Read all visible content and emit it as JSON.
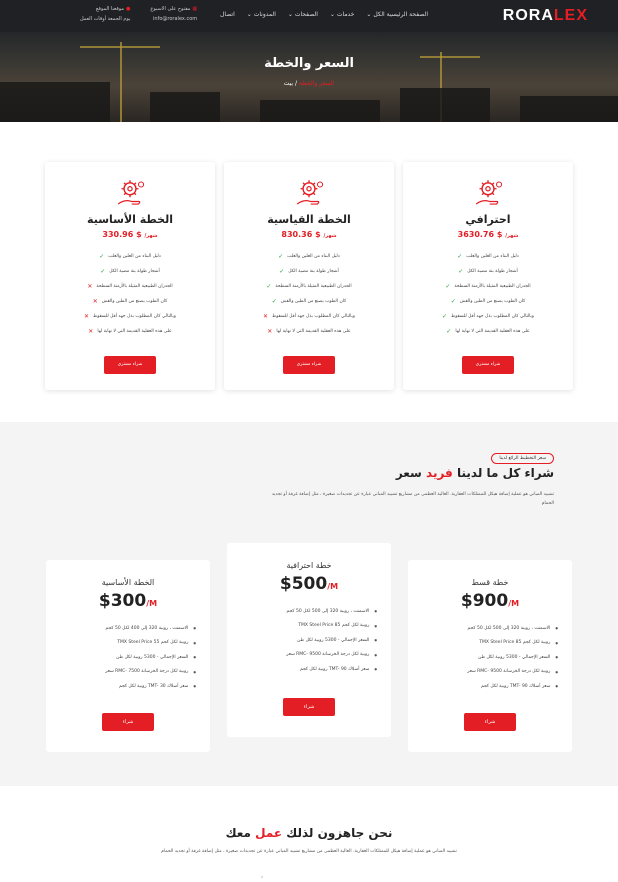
{
  "header": {
    "logo_main": "RORA",
    "logo_accent": "LEX",
    "nav": [
      "الصفحة الرئيسية الكل",
      "خدمات",
      "الصفحات",
      "المدونات",
      "اتصال"
    ],
    "contact": {
      "hours_label": "مفتوح على الاسبوع",
      "hours_value": "يوم الجمعة أوقات العمل",
      "location_label": "موقعنا الموقع",
      "email": "info@roralex.com"
    }
  },
  "hero": {
    "title": "السعر والخطة",
    "crumb_home": "بيت",
    "crumb_sep": " / ",
    "crumb_current": "السعر والخطة"
  },
  "plans_top": [
    {
      "title": "الخطة الأساسية",
      "price": "$ 330.96",
      "per": "شهر/",
      "button": "شراء مشتري",
      "features": [
        {
          "text": "دليل البناء من العلين والعلب",
          "ok": true
        },
        {
          "text": "أشجار طولة بنة مضية الكل",
          "ok": true
        },
        {
          "text": "الجدران الطبيعية المثيلة بالأزمنة السطحة",
          "ok": false
        },
        {
          "text": "كان الطوب يصنع من الطين والقش",
          "ok": false
        },
        {
          "text": "وبالتالي كان المطلوب بذل جهد أقل للسقوط",
          "ok": false
        },
        {
          "text": "على هذه العقلية القديمة التي لا نهاية لها",
          "ok": false
        }
      ]
    },
    {
      "title": "الخطة القياسية",
      "price": "$ 830.36",
      "per": "شهر/",
      "button": "شراء مشتري",
      "features": [
        {
          "text": "دليل البناء من العلين والعلب",
          "ok": true
        },
        {
          "text": "أشجار طولة بنة مضية الكل",
          "ok": true
        },
        {
          "text": "الجدران الطبيعية المثيلة بالأزمنة السطحة",
          "ok": true
        },
        {
          "text": "كان الطوب يصنع من الطين والقش",
          "ok": true
        },
        {
          "text": "وبالتالي كان المطلوب بذل جهد أقل للسقوط",
          "ok": false
        },
        {
          "text": "على هذه العقلية القديمة التي لا نهاية لها",
          "ok": false
        }
      ]
    },
    {
      "title": "احترافي",
      "price": "$ 3630.76",
      "per": "شهر/",
      "button": "شراء مشتري",
      "features": [
        {
          "text": "دليل البناء من العلين والعلب",
          "ok": true
        },
        {
          "text": "أشجار طولة بنة مضية الكل",
          "ok": true
        },
        {
          "text": "الجدران الطبيعية المثيلة بالأزمنة السطحة",
          "ok": true
        },
        {
          "text": "كان الطوب يصنع من الطين والقش",
          "ok": true
        },
        {
          "text": "وبالتالي كان المطلوب بذل جهد أقل للسقوط",
          "ok": true
        },
        {
          "text": "على هذه العقلية القديمة التي لا نهاية لها",
          "ok": true
        }
      ]
    }
  ],
  "section2": {
    "badge": "سعر التخطيط الرائع لدينا",
    "title_a": "شراء كل ما لدينا ",
    "title_accent": "فريد",
    "title_b": " سعر",
    "desc": "تشييد المباني هو عملية إضافة هيكل للممتلكات العقارية. العالية العظمى من مشاريع تشييد المباني عبارة عن تجديدات صغيرة ، مثل إضافة غرفة أو تجديد الحمام"
  },
  "plans_bottom": [
    {
      "title": "الخطة الأساسية",
      "price": "$300",
      "per": "/M",
      "button": "شراء",
      "features": [
        "الاسمنت ، روبية 320 إلى 400 لكل 50 كجم",
        "روبية لكل كجم 55 TMX Steel Price",
        "السعر الإجمالي - 5300 روبية لكل طن",
        "روبية لكل درجة الخرسانة RMC- 7500 سعر",
        "سعر أسلاك TMT- 30 روبية لكل كجم"
      ]
    },
    {
      "title": "خطة احترافية",
      "price": "$500",
      "per": "/M",
      "button": "شراء",
      "features": [
        "الاسمنت ، روبية 320 إلى 500 لكل 50 كجم",
        "روبية لكل كجم 85 TMX Steel Price",
        "السعر الإجمالي - 5300 روبية لكل طن",
        "روبية لكل درجة الخرسانة RMC- 9500 سعر",
        "سعر أسلاك TMT- 90 روبية لكل كجم"
      ]
    },
    {
      "title": "خطة قسط",
      "price": "$900",
      "per": "/M",
      "button": "شراء",
      "features": [
        "الاسمنت ، روبية 320 إلى 500 لكل 50 كجم",
        "روبية لكل كجم 85 TMX Steel Price",
        "السعر الإجمالي - 5300 روبية لكل طن",
        "روبية لكل درجة الخرسانة RMC- 9500 سعر",
        "سعر أسلاك TMT- 90 روبية لكل كجم"
      ]
    }
  ],
  "section3": {
    "title_a": "نحن جاهزون لذلك ",
    "title_accent": "عمل",
    "title_b": " معك",
    "desc": "تشييد المباني هو عملية إضافة هيكل للممتلكات العقارية. العالية العظمى من مشاريع تشييد المباني عبارة عن تجديدات صغيرة ، مثل إضافة غرفة أو تجديد الحمام"
  }
}
